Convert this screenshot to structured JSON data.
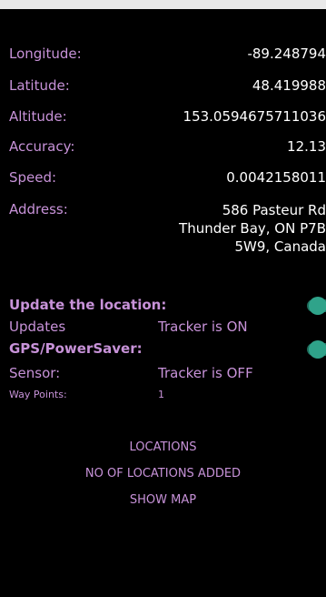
{
  "info": {
    "longitude_label": "Longitude:",
    "longitude_value": "-89.248794",
    "latitude_label": "Latitude:",
    "latitude_value": "48.419988",
    "altitude_label": "Altitude:",
    "altitude_value": "153.0594675711036",
    "accuracy_label": "Accuracy:",
    "accuracy_value": "12.13",
    "speed_label": "Speed:",
    "speed_value": "0.0042158011",
    "address_label": "Address:",
    "address_line1": "586 Pasteur Rd",
    "address_line2": "Thunder Bay, ON P7B",
    "address_line3": "5W9, Canada"
  },
  "controls": {
    "update_location_label": "Update the location:",
    "updates_label": "Updates",
    "updates_status": "Tracker is ON",
    "gps_label": "GPS/PowerSaver:",
    "sensor_label": "Sensor:",
    "sensor_status": "Tracker is OFF",
    "waypoints_label": "Way Points:",
    "waypoints_value": "1",
    "update_location_toggle_on": true,
    "gps_toggle_on": true
  },
  "links": {
    "locations": "LOCATIONS",
    "no_locations": "NO OF LOCATIONS ADDED",
    "show_map": "SHOW MAP"
  }
}
